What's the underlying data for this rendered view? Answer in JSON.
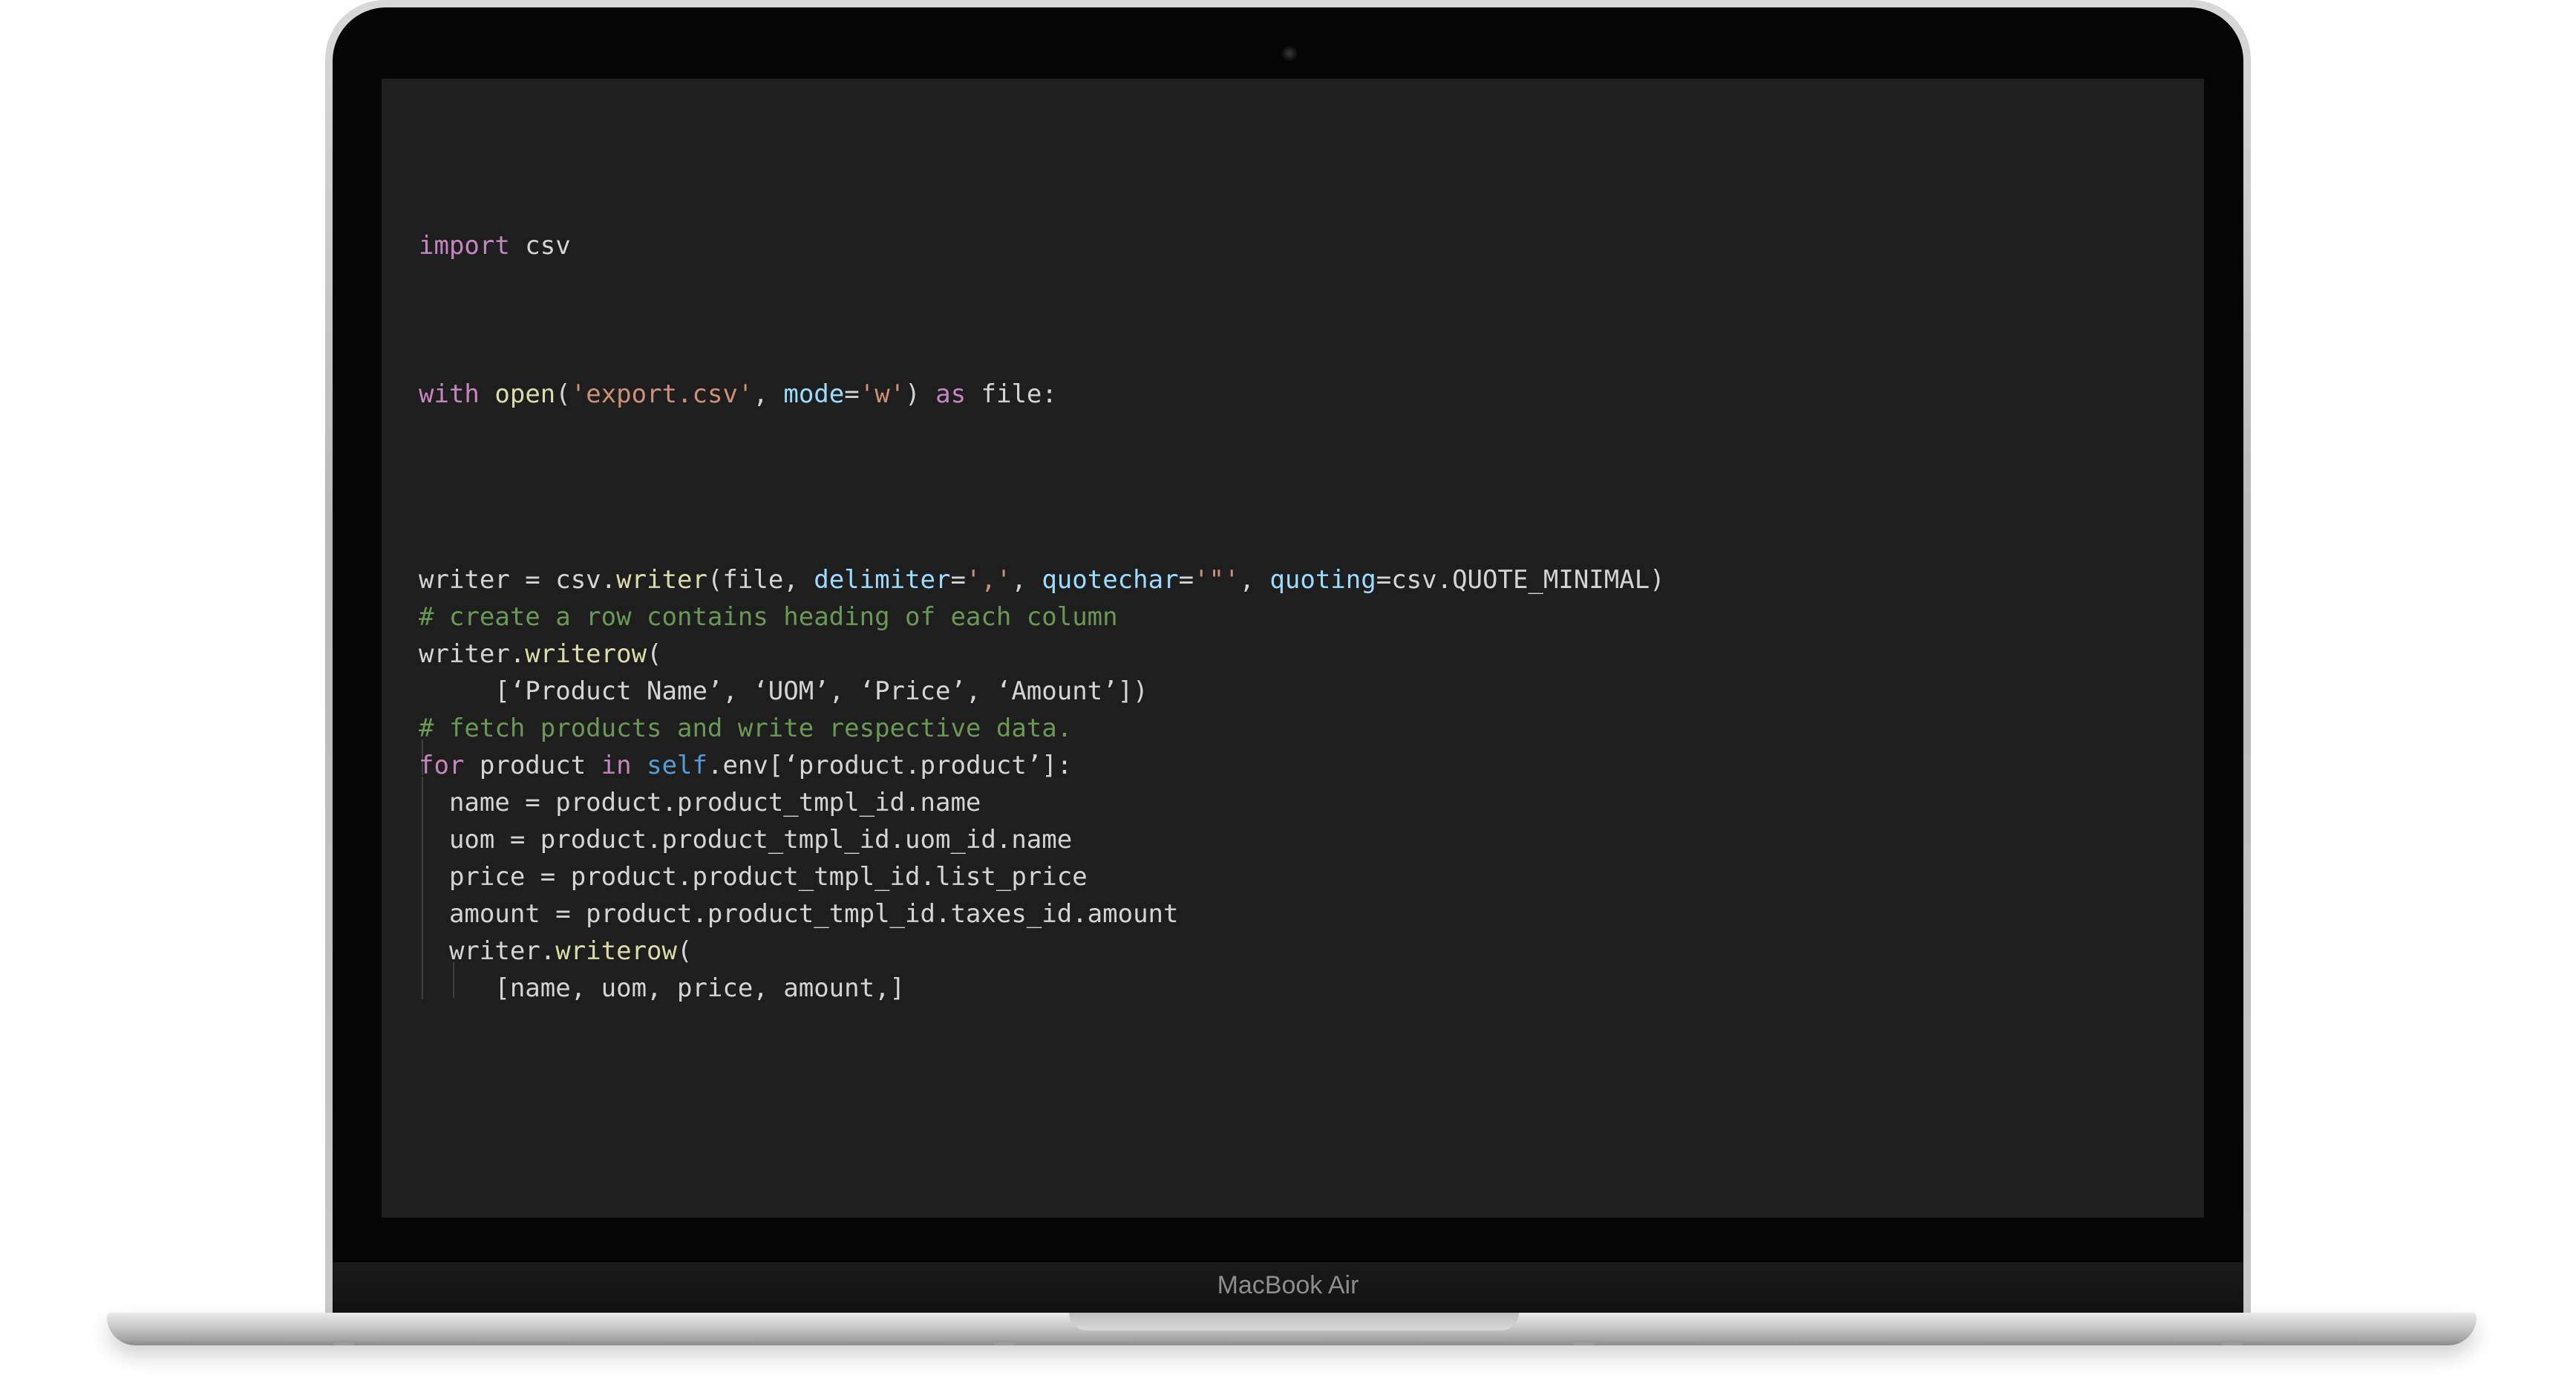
{
  "device": {
    "brand_label": "MacBook Air"
  },
  "editor": {
    "lines": [
      {
        "tokens": [
          {
            "t": "import",
            "c": "kw"
          },
          {
            "t": " csv",
            "c": "plain"
          }
        ]
      },
      {
        "tokens": [
          {
            "t": "with",
            "c": "kw"
          },
          {
            "t": " ",
            "c": "plain"
          },
          {
            "t": "open",
            "c": "fn"
          },
          {
            "t": "(",
            "c": "plain"
          },
          {
            "t": "'export.csv'",
            "c": "str"
          },
          {
            "t": ", ",
            "c": "plain"
          },
          {
            "t": "mode",
            "c": "id"
          },
          {
            "t": "=",
            "c": "plain"
          },
          {
            "t": "'w'",
            "c": "str"
          },
          {
            "t": ") ",
            "c": "plain"
          },
          {
            "t": "as",
            "c": "kw"
          },
          {
            "t": " file:",
            "c": "plain"
          }
        ]
      },
      {
        "tokens": [
          {
            "t": "writer = csv.",
            "c": "plain"
          },
          {
            "t": "writer",
            "c": "fn"
          },
          {
            "t": "(file, ",
            "c": "plain"
          },
          {
            "t": "delimiter",
            "c": "id"
          },
          {
            "t": "=",
            "c": "plain"
          },
          {
            "t": "','",
            "c": "str"
          },
          {
            "t": ", ",
            "c": "plain"
          },
          {
            "t": "quotechar",
            "c": "id"
          },
          {
            "t": "=",
            "c": "plain"
          },
          {
            "t": "'\"'",
            "c": "str"
          },
          {
            "t": ", ",
            "c": "plain"
          },
          {
            "t": "quoting",
            "c": "id"
          },
          {
            "t": "=csv.QUOTE_MINIMAL)",
            "c": "plain"
          }
        ]
      },
      {
        "tokens": [
          {
            "t": "# create a row contains heading of each column",
            "c": "cm"
          }
        ]
      },
      {
        "tokens": [
          {
            "t": "writer.",
            "c": "plain"
          },
          {
            "t": "writerow",
            "c": "fn"
          },
          {
            "t": "(",
            "c": "plain"
          }
        ]
      },
      {
        "tokens": [
          {
            "t": "     [‘Product Name’, ‘UOM’, ‘Price’, ‘Amount’])",
            "c": "plain"
          }
        ]
      },
      {
        "tokens": [
          {
            "t": "# fetch products and write respective data.",
            "c": "cm"
          }
        ]
      },
      {
        "tokens": [
          {
            "t": "for",
            "c": "kw"
          },
          {
            "t": " product ",
            "c": "plain"
          },
          {
            "t": "in",
            "c": "kw"
          },
          {
            "t": " ",
            "c": "plain"
          },
          {
            "t": "self",
            "c": "kw2"
          },
          {
            "t": ".env[‘product.product’]:",
            "c": "plain"
          }
        ]
      },
      {
        "tokens": [
          {
            "t": "  name = product.product_tmpl_id.name",
            "c": "plain"
          }
        ]
      },
      {
        "tokens": [
          {
            "t": "  uom = product.product_tmpl_id.uom_id.name",
            "c": "plain"
          }
        ]
      },
      {
        "tokens": [
          {
            "t": "  price = product.product_tmpl_id.list_price",
            "c": "plain"
          }
        ]
      },
      {
        "tokens": [
          {
            "t": "  amount = product.product_tmpl_id.taxes_id.amount",
            "c": "plain"
          }
        ]
      },
      {
        "tokens": [
          {
            "t": "  writer.",
            "c": "plain"
          },
          {
            "t": "writerow",
            "c": "fn"
          },
          {
            "t": "(",
            "c": "plain"
          }
        ]
      },
      {
        "tokens": [
          {
            "t": "     [name, uom, price, amount,]",
            "c": "plain"
          }
        ]
      }
    ]
  }
}
